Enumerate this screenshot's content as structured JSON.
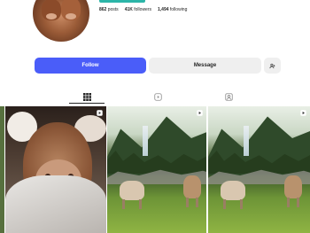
{
  "profile": {
    "stats": {
      "posts_value": "862",
      "posts_label": "posts",
      "followers_value": "41K",
      "followers_label": "followers",
      "following_value": "1,494",
      "following_label": "following"
    }
  },
  "actions": {
    "follow_label": "Follow",
    "message_label": "Message",
    "suggest_icon": "add-person-icon"
  },
  "tabs": [
    {
      "icon": "grid-icon",
      "selected": true
    },
    {
      "icon": "reels-icon",
      "selected": false
    },
    {
      "icon": "tagged-icon",
      "selected": false
    }
  ],
  "grid": {
    "tiles": [
      {
        "subject": "calf-closeup",
        "badge": "reel-icon"
      },
      {
        "subject": "alpine-cows",
        "badge": "reel-icon"
      },
      {
        "subject": "alpine-cows",
        "badge": "reel-icon"
      }
    ]
  },
  "colors": {
    "follow": "#4a5df9",
    "secondary_button": "#efefef",
    "accent": "#2cb5a8"
  }
}
